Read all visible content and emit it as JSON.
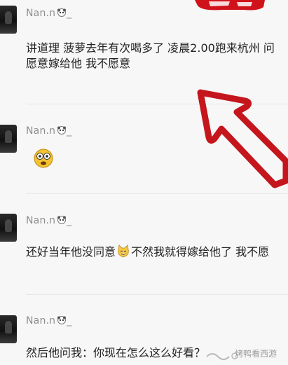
{
  "comments": [
    {
      "username": "Nan.n",
      "name_suffix": "_",
      "text": "讲道理 菠萝去年有次喝多了 凌晨2.00跑来杭州 问我愿不愿意嫁给他 我不愿意",
      "line1": "讲道理 菠萝去年有次喝多了 凌晨2.00跑来杭州 问",
      "line2": "愿意嫁给他 我不愿意"
    },
    {
      "username": "Nan.n",
      "name_suffix": "_",
      "emoji": "dizzy-face"
    },
    {
      "username": "Nan.n",
      "name_suffix": "_",
      "text_before": "还好当年他没同意",
      "text_after": "不然我就得嫁给他了 我不愿"
    },
    {
      "username": "Nan.n",
      "name_suffix": "_",
      "text": "然后他问我：你现在怎么这么好看？"
    }
  ],
  "watermark": "烤鸭看西游",
  "colors": {
    "arrow": "#c4161c",
    "banner": "#d0121a"
  }
}
